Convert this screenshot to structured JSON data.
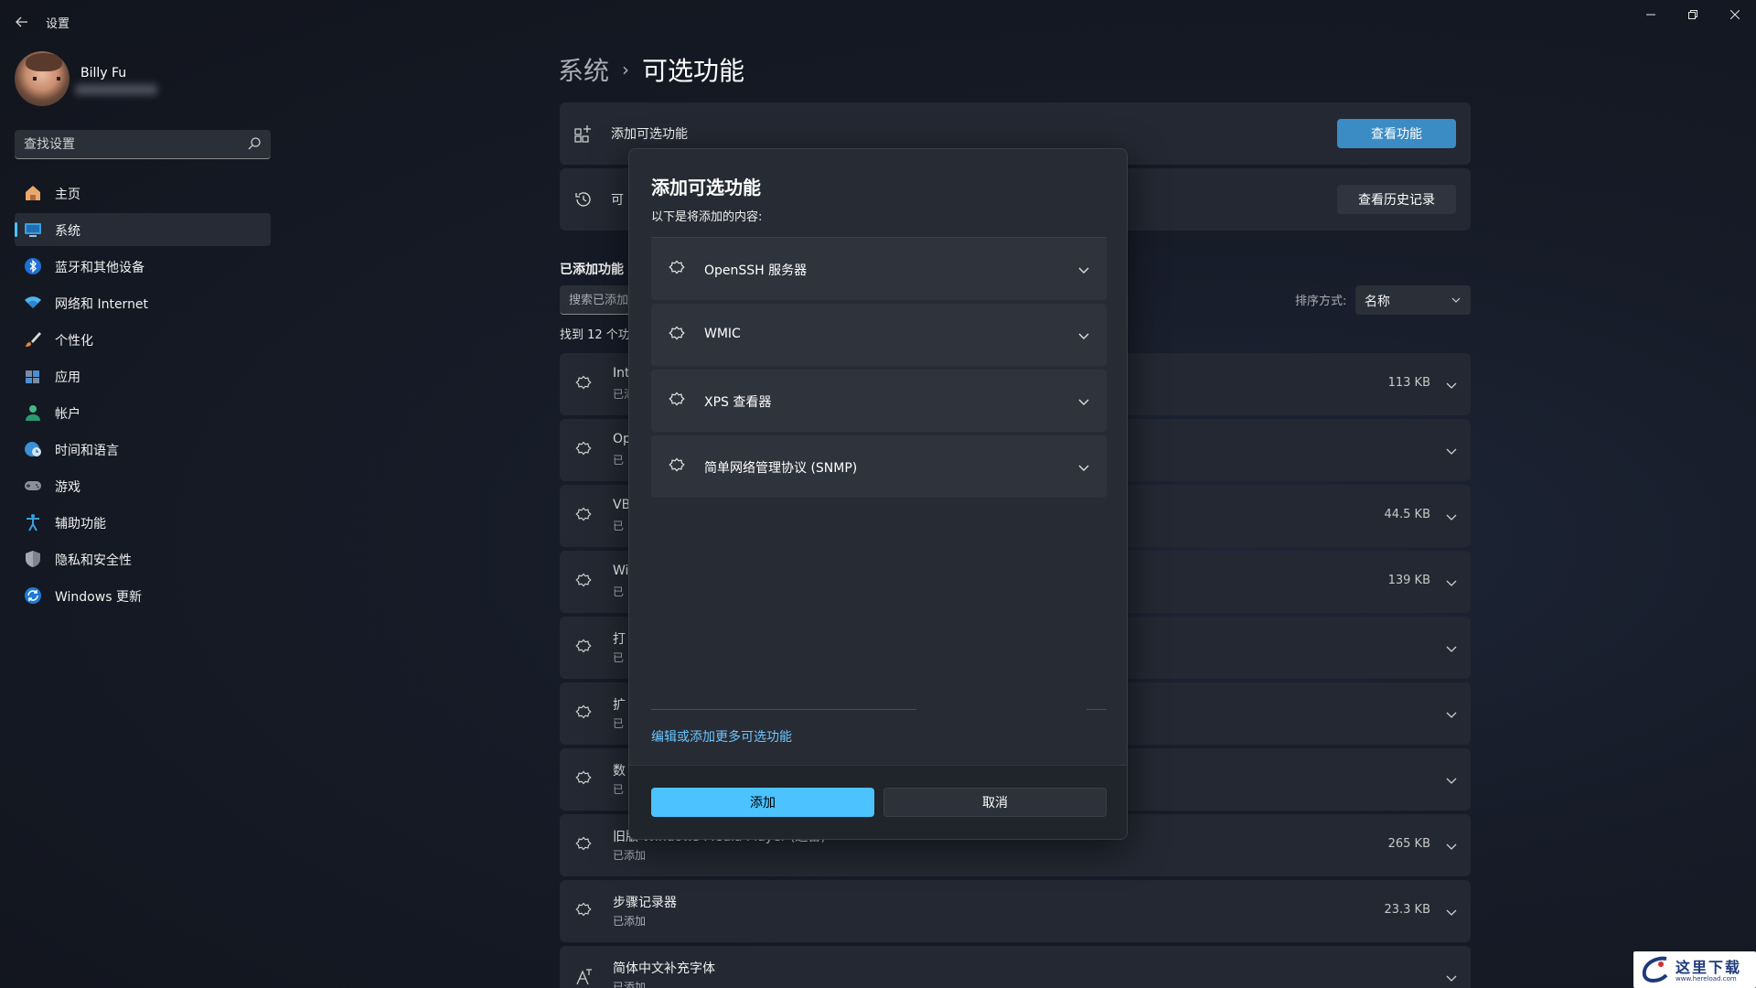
{
  "window": {
    "app_title": "设置",
    "minimize_icon": "minimize-icon",
    "maximize_icon": "restore-icon",
    "close_icon": "close-icon"
  },
  "profile": {
    "name": "Billy Fu"
  },
  "search": {
    "placeholder": "查找设置"
  },
  "sidebar": {
    "items": [
      {
        "label": "主页",
        "icon": "home-icon",
        "active": false
      },
      {
        "label": "系统",
        "icon": "system-icon",
        "active": true
      },
      {
        "label": "蓝牙和其他设备",
        "icon": "bluetooth-icon",
        "active": false
      },
      {
        "label": "网络和 Internet",
        "icon": "wifi-icon",
        "active": false
      },
      {
        "label": "个性化",
        "icon": "brush-icon",
        "active": false
      },
      {
        "label": "应用",
        "icon": "apps-icon",
        "active": false
      },
      {
        "label": "帐户",
        "icon": "account-icon",
        "active": false
      },
      {
        "label": "时间和语言",
        "icon": "globe-clock-icon",
        "active": false
      },
      {
        "label": "游戏",
        "icon": "gamepad-icon",
        "active": false
      },
      {
        "label": "辅助功能",
        "icon": "accessibility-icon",
        "active": false
      },
      {
        "label": "隐私和安全性",
        "icon": "shield-icon",
        "active": false
      },
      {
        "label": "Windows 更新",
        "icon": "update-icon",
        "active": false
      }
    ],
    "accent_color": "#4cc2ff"
  },
  "breadcrumb": {
    "parent": "系统",
    "separator": "›",
    "current": "可选功能"
  },
  "main": {
    "add_card": {
      "label": "添加可选功能",
      "button": "查看功能"
    },
    "history_card": {
      "label": "可",
      "button": "查看历史记录"
    },
    "added_section_title": "已添加功能",
    "search_added_placeholder": "搜索已添加",
    "found_count": "找到 12 个功",
    "sort_label": "排序方式:",
    "sort_value": "名称",
    "features": [
      {
        "name": "Int",
        "status": "已添",
        "size": "113 KB"
      },
      {
        "name": "Op",
        "status": "已",
        "size": ""
      },
      {
        "name": "VB",
        "status": "已",
        "size": "44.5 KB"
      },
      {
        "name": "Wi",
        "status": "已",
        "size": "139 KB"
      },
      {
        "name": "打",
        "status": "已",
        "size": ""
      },
      {
        "name": "扩",
        "status": "已",
        "size": ""
      },
      {
        "name": "数",
        "status": "已",
        "size": ""
      },
      {
        "name": "旧版 Windows Media Player (遗留)",
        "status": "已添加",
        "size": "265 KB"
      },
      {
        "name": "步骤记录器",
        "status": "已添加",
        "size": "23.3 KB"
      },
      {
        "name": "简体中文补充字体",
        "status": "已添加",
        "size": ""
      }
    ]
  },
  "dialog": {
    "title": "添加可选功能",
    "subtitle": "以下是将添加的内容:",
    "items": [
      {
        "label": "OpenSSH 服务器"
      },
      {
        "label": "WMIC"
      },
      {
        "label": "XPS 查看器"
      },
      {
        "label": "简单网络管理协议 (SNMP)"
      }
    ],
    "link": "编辑或添加更多可选功能",
    "add_button": "添加",
    "cancel_button": "取消",
    "accent_color": "#4cc2ff"
  },
  "watermark": {
    "text": "这里下载",
    "url": "www.hereload.com"
  }
}
